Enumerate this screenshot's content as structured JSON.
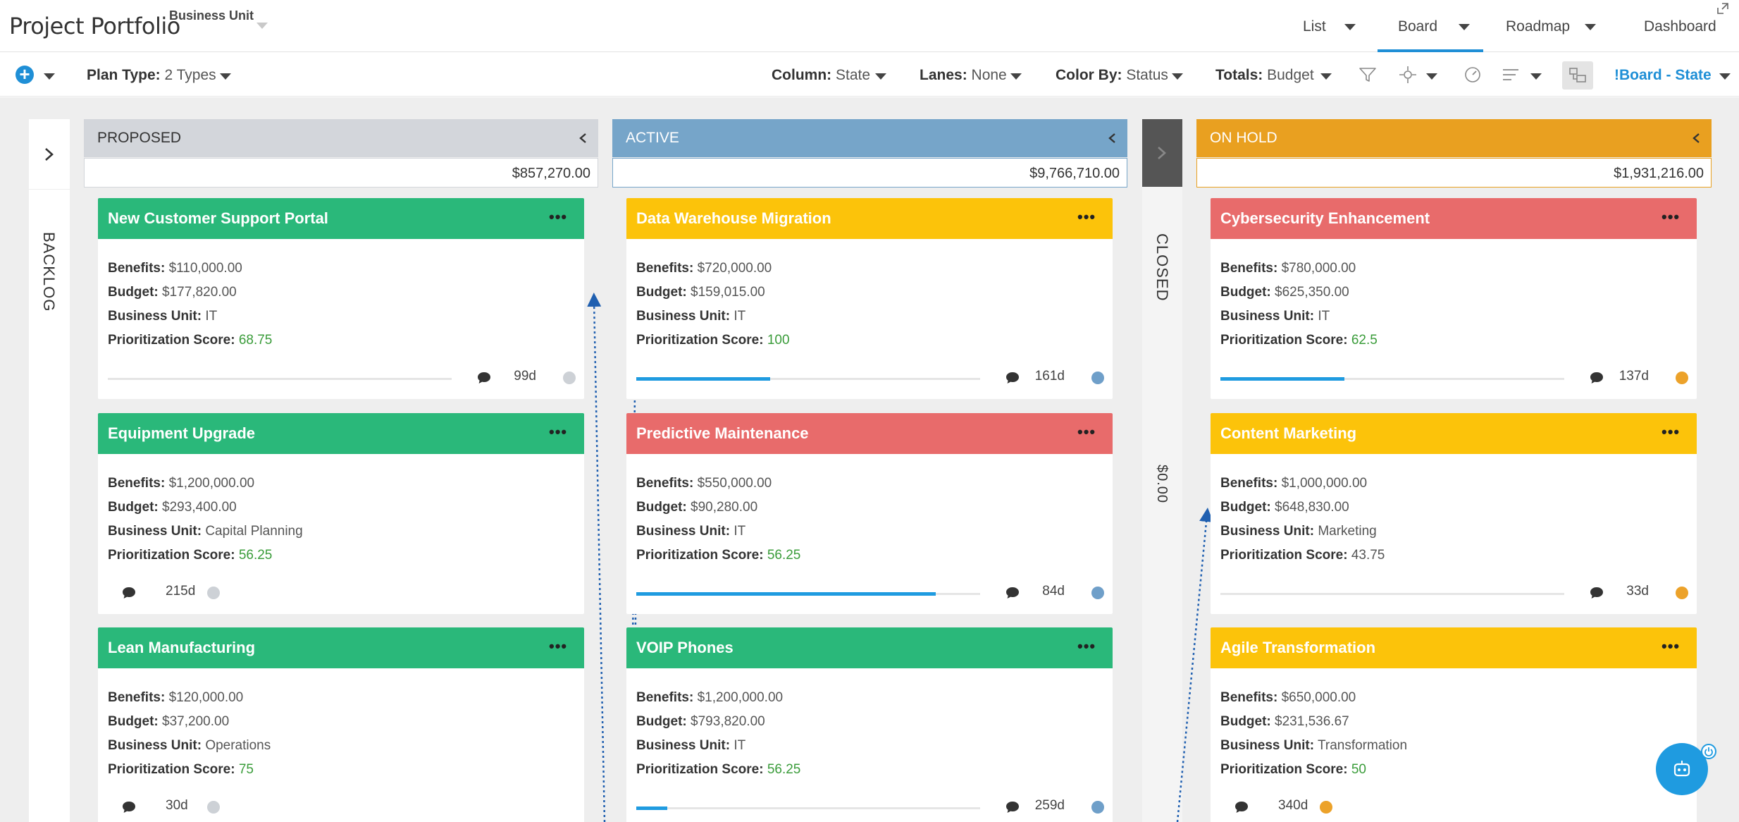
{
  "header": {
    "app_title": "Project Portfolio",
    "business_unit_label": "Business Unit",
    "views": [
      {
        "label": "List"
      },
      {
        "label": "Board"
      },
      {
        "label": "Roadmap"
      },
      {
        "label": "Dashboard"
      }
    ],
    "active_view": "Board"
  },
  "toolbar": {
    "plan_type_label": "Plan Type:",
    "plan_type_value": "2 Types",
    "column_label": "Column:",
    "column_value": "State",
    "lanes_label": "Lanes:",
    "lanes_value": "None",
    "color_by_label": "Color By:",
    "color_by_value": "Status",
    "totals_label": "Totals:",
    "totals_value": "Budget",
    "board_view_name": "!Board - State",
    "icons": [
      "add-icon",
      "filter-icon",
      "move-icon",
      "gauge-icon",
      "list-sort-icon",
      "board-layout-icon"
    ]
  },
  "collapsed_columns": {
    "backlog": {
      "label": "BACKLOG"
    },
    "closed": {
      "label": "CLOSED",
      "total": "$0.00"
    }
  },
  "columns": [
    {
      "name": "PROPOSED",
      "total": "$857,270.00",
      "color": "#d3d6db",
      "cards": [
        {
          "title": "New Customer Support Portal",
          "status_color": "#2ab87a",
          "benefits": "$110,000.00",
          "budget": "$177,820.00",
          "business_unit": "IT",
          "score": "68.75",
          "progress": 0,
          "days": "99d",
          "dot_color": "#cdd1d6"
        },
        {
          "title": "Equipment Upgrade",
          "status_color": "#2ab87a",
          "benefits": "$1,200,000.00",
          "budget": "$293,400.00",
          "business_unit": "Capital Planning",
          "score": "56.25",
          "progress": null,
          "days": "215d",
          "dot_color": "#cdd1d6"
        },
        {
          "title": "Lean Manufacturing",
          "status_color": "#2ab87a",
          "benefits": "$120,000.00",
          "budget": "$37,200.00",
          "business_unit": "Operations",
          "score": "75",
          "progress": null,
          "days": "30d",
          "dot_color": "#cdd1d6"
        }
      ]
    },
    {
      "name": "ACTIVE",
      "total": "$9,766,710.00",
      "color": "#76a5c9",
      "cards": [
        {
          "title": "Data Warehouse Migration",
          "status_color": "#fcc30a",
          "benefits": "$720,000.00",
          "budget": "$159,015.00",
          "business_unit": "IT",
          "score": "100",
          "progress": 0.39,
          "days": "161d",
          "dot_color": "#6f9fc9"
        },
        {
          "title": "Predictive Maintenance",
          "status_color": "#e86b6b",
          "benefits": "$550,000.00",
          "budget": "$90,280.00",
          "business_unit": "IT",
          "score": "56.25",
          "progress": 0.87,
          "days": "84d",
          "dot_color": "#6f9fc9"
        },
        {
          "title": "VOIP Phones",
          "status_color": "#2ab87a",
          "benefits": "$1,200,000.00",
          "budget": "$793,820.00",
          "business_unit": "IT",
          "score": "56.25",
          "progress": 0.09,
          "days": "259d",
          "dot_color": "#6f9fc9"
        }
      ]
    },
    {
      "name": "ON HOLD",
      "total": "$1,931,216.00",
      "color": "#e9a020",
      "cards": [
        {
          "title": "Cybersecurity Enhancement",
          "status_color": "#e86b6b",
          "benefits": "$780,000.00",
          "budget": "$625,350.00",
          "business_unit": "IT",
          "score": "62.5",
          "progress": 0.36,
          "days": "137d",
          "dot_color": "#eca22a"
        },
        {
          "title": "Content Marketing",
          "status_color": "#fcc30a",
          "benefits": "$1,000,000.00",
          "budget": "$648,830.00",
          "business_unit": "Marketing",
          "score": "43.75",
          "progress": 0,
          "days": "33d",
          "dot_color": "#eca22a"
        },
        {
          "title": "Agile Transformation",
          "status_color": "#fcc30a",
          "benefits": "$650,000.00",
          "budget": "$231,536.67",
          "business_unit": "Transformation",
          "score": "50",
          "progress": null,
          "days": "340d",
          "dot_color": "#eca22a"
        }
      ]
    }
  ],
  "labels": {
    "benefits": "Benefits:",
    "budget": "Budget:",
    "business_unit": "Business Unit:",
    "score": "Prioritization Score:"
  },
  "colors": {
    "accent": "#1f8fd6",
    "green": "#2ab87a",
    "yellow": "#fcc30a",
    "red": "#e86b6b"
  }
}
